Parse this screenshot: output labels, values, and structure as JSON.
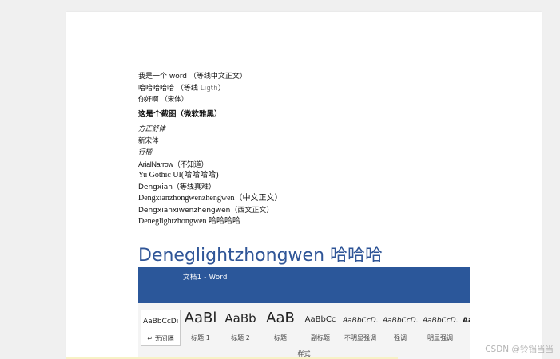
{
  "document": {
    "lines": [
      "我是一个 word （等线中文正文）",
      "哈哈哈哈哈 （等线 Ligth）",
      "你好啊 （宋体）",
      "这是个截图（微软雅黑）",
      "方正舒体",
      "新宋体",
      "行楷",
      "ArialNarrow（不知道）",
      "Yu Gothic UI(哈哈哈哈)",
      "Dengxian（等线真难）",
      "Dengxianzhongwenzhengwen（中文正文）",
      "Dengxianxiwenzhengwen（西文正文）",
      "Deneglightzhongwen 哈哈哈哈"
    ],
    "big_heading": "Deneglightzhongwen 哈哈哈"
  },
  "word_screenshot": {
    "title": "文档1  -  Word",
    "titlebar_color": "#2b579a",
    "styles": [
      {
        "preview": "AaBbCcDı",
        "caption": "↵ 无间隔"
      },
      {
        "preview": "AaBl",
        "caption": "标题 1"
      },
      {
        "preview": "AaBb",
        "caption": "标题 2"
      },
      {
        "preview": "AaB",
        "caption": "标题"
      },
      {
        "preview": "AaBbCc",
        "caption": "副标题"
      },
      {
        "preview": "AaBbCcD.",
        "caption": "不明显强调"
      },
      {
        "preview": "AaBbCcD.",
        "caption": "强调"
      },
      {
        "preview": "AaBbCcD.",
        "caption": "明显强调"
      },
      {
        "preview": "Aa",
        "caption": ""
      }
    ],
    "group_label": "样式"
  },
  "watermark": "CSDN @铃铛当当",
  "colors": {
    "heading_blue": "#2f5597",
    "ribbon_bg": "#f4f4f4",
    "page_bg": "#ffffff",
    "desk_bg": "#f0f0f0"
  }
}
